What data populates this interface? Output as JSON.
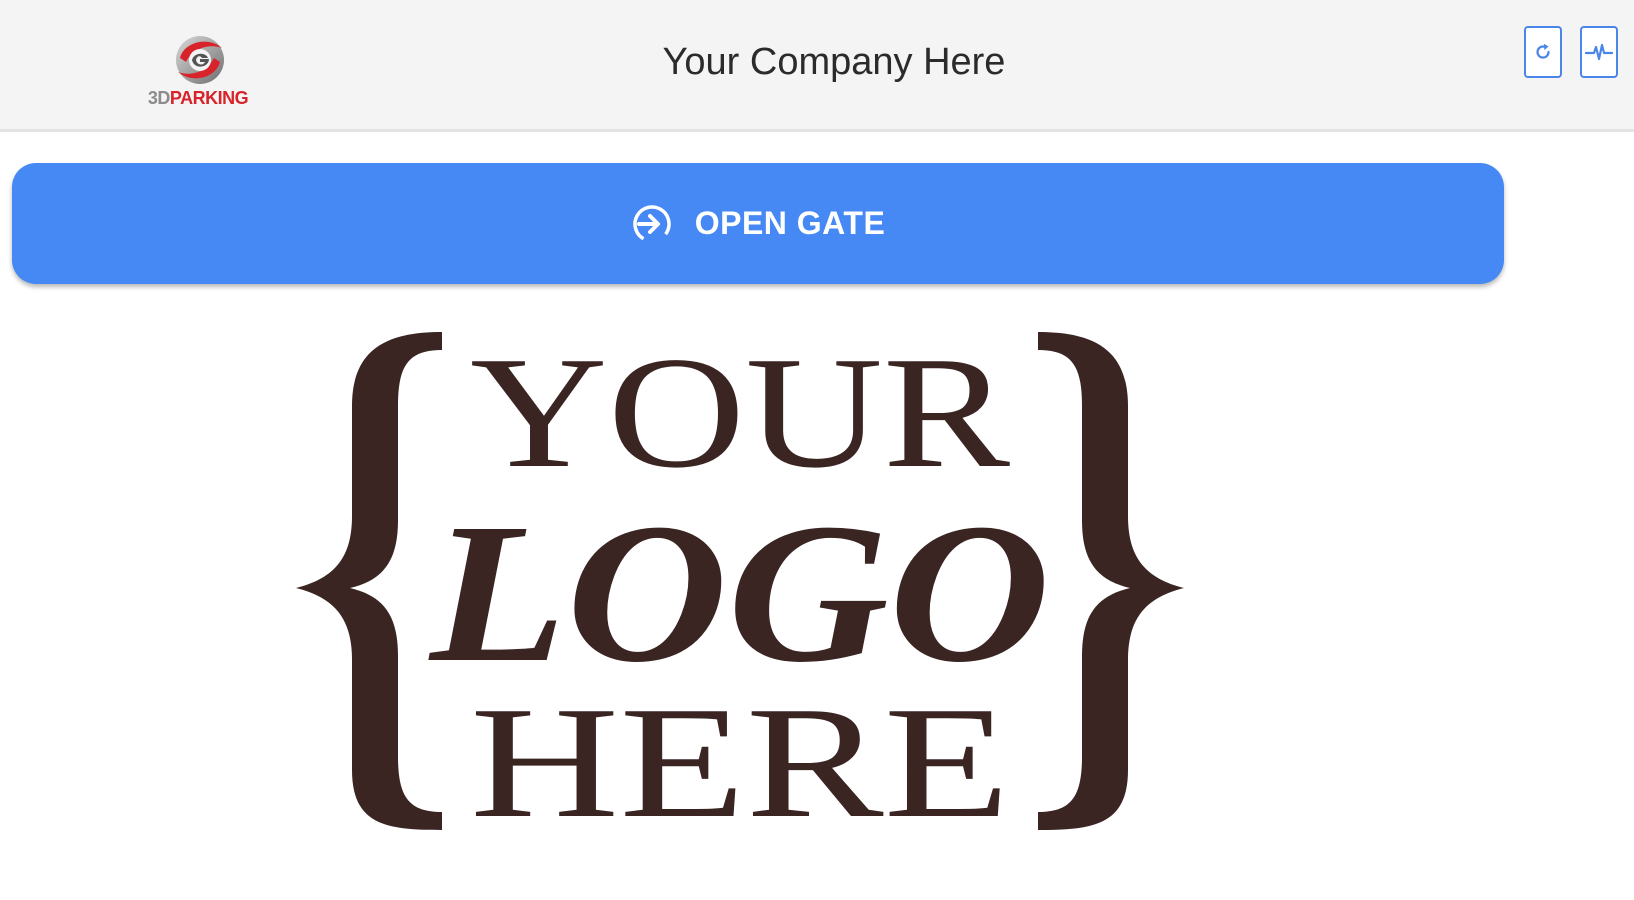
{
  "header": {
    "brand": {
      "text_left": "3D",
      "text_right": "PARKING",
      "icon": "3dparking-logo-icon"
    },
    "title": "Your Company Here",
    "buttons": [
      {
        "icon": "refresh-icon"
      },
      {
        "icon": "activity-icon"
      }
    ]
  },
  "main": {
    "open_gate": {
      "label": "OPEN GATE",
      "icon": "login-arrow-icon"
    },
    "logo": {
      "line1": "YOUR",
      "line2": "LOGO",
      "line3": "HERE",
      "color": "#3a2523"
    }
  },
  "colors": {
    "header_bg": "#f4f4f4",
    "accent_blue": "#4689f5",
    "icon_border": "#4a86e8",
    "brand_red": "#d8232a",
    "brand_gray": "#8c8c8c"
  }
}
